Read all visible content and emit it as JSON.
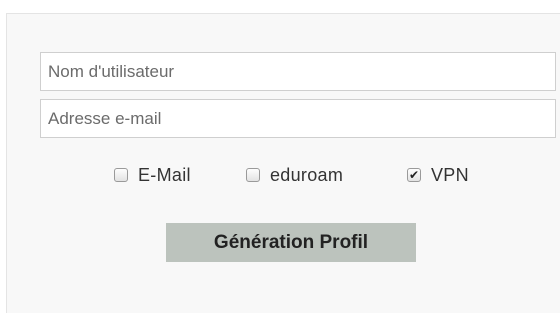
{
  "form": {
    "username": {
      "value": "",
      "placeholder": "Nom d'utilisateur"
    },
    "email": {
      "value": "",
      "placeholder": "Adresse e-mail"
    },
    "options": [
      {
        "label": "E-Mail",
        "checked": false
      },
      {
        "label": "eduroam",
        "checked": false
      },
      {
        "label": "VPN",
        "checked": true
      }
    ],
    "submit_label": "Génération Profil"
  },
  "colors": {
    "panel_bg": "#f8f8f8",
    "button_bg": "#bcc3bd",
    "input_border": "#cfcfcf"
  }
}
